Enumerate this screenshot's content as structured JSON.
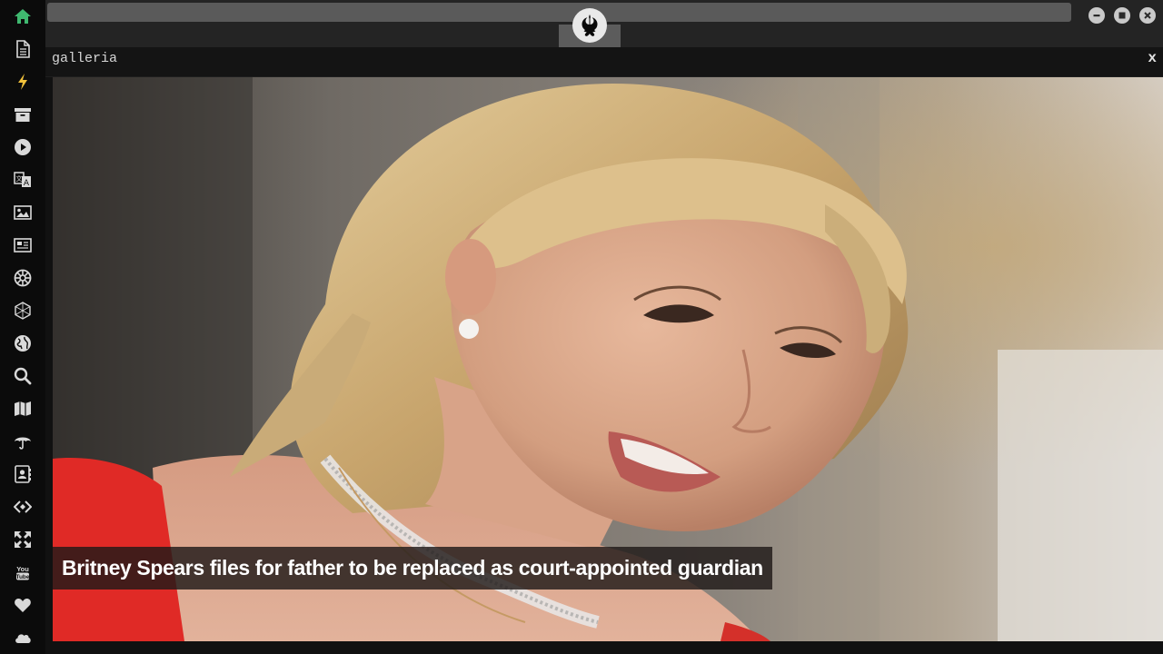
{
  "sidebar": {
    "items": [
      {
        "icon": "home-icon",
        "color": "#3fb86f"
      },
      {
        "icon": "document-icon"
      },
      {
        "icon": "lightning-icon",
        "color": "#f2c23b"
      },
      {
        "icon": "archive-icon"
      },
      {
        "icon": "play-icon"
      },
      {
        "icon": "translate-icon"
      },
      {
        "icon": "image-icon"
      },
      {
        "icon": "newspaper-icon"
      },
      {
        "icon": "galactic-empire-icon"
      },
      {
        "icon": "hexagon-network-icon"
      },
      {
        "icon": "globe-icon"
      },
      {
        "icon": "search-icon"
      },
      {
        "icon": "map-icon"
      },
      {
        "icon": "umbrella-icon"
      },
      {
        "icon": "contacts-icon"
      },
      {
        "icon": "code-icon"
      },
      {
        "icon": "expand-icon"
      },
      {
        "icon": "youtube-icon"
      },
      {
        "icon": "heart-icon"
      },
      {
        "icon": "cloud-icon"
      }
    ]
  },
  "window": {
    "logo": "rebel-alliance-icon",
    "controls": [
      "minimize-icon",
      "maximize-icon",
      "close-icon"
    ]
  },
  "gallery": {
    "title": "galleria",
    "close_label": "x",
    "caption": "Britney Spears files for father to be replaced as court-appointed guardian"
  }
}
